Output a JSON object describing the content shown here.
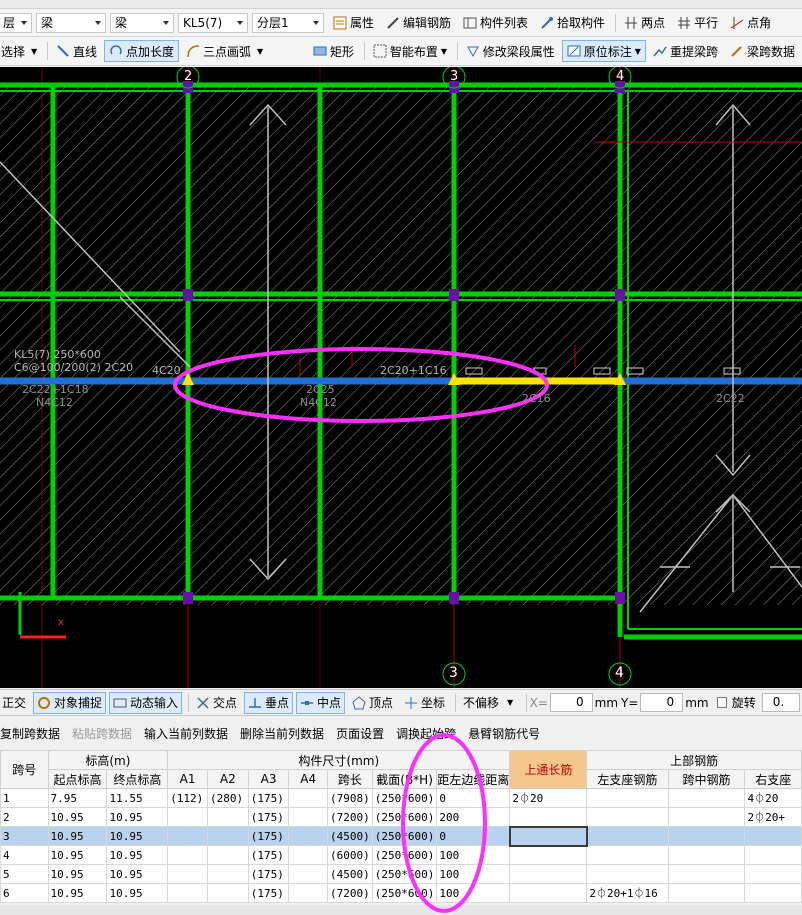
{
  "toolbar1": {
    "floor_value": "层",
    "category_value": "梁",
    "type_value": "梁",
    "component_value": "KL5(7)",
    "layer_value": "分层1",
    "properties_label": "属性",
    "edit_rebar_label": "编辑钢筋",
    "component_list_label": "构件列表",
    "pick_component_label": "拾取构件",
    "two_points_label": "两点",
    "parallel_label": "平行",
    "point_angle_label": "点角"
  },
  "toolbar2": {
    "select_label": "选择",
    "line_label": "直线",
    "point_length_label": "点加长度",
    "three_point_arc_label": "三点画弧",
    "rectangle_label": "矩形",
    "smart_layout_label": "智能布置",
    "modify_segment_label": "修改梁段属性",
    "in_place_label": "原位标注",
    "re_extract_span_label": "重提梁跨",
    "span_data_label": "梁跨数据"
  },
  "canvas": {
    "axis_labels": [
      "2",
      "3",
      "4"
    ],
    "bottom_axis_labels": [
      "3",
      "4"
    ],
    "beam_label_1": "KL5(7) 250*600",
    "beam_label_2": "C6@100/200(2) 2C20",
    "beam_label_3": "2C22+1C18",
    "beam_label_4": "N4C12",
    "beam_label_5": "4C20",
    "beam_label_6": "2C25",
    "beam_label_7": "N4C12",
    "beam_label_8": "2C20+1C16",
    "beam_label_9": "2C16",
    "beam_label_10": "2C22",
    "colors": {
      "grid": "#00d000",
      "beam": "#1f6fd6",
      "selected": "#ffe400",
      "highlight": "#ff30ff",
      "column": "#6a0dad"
    }
  },
  "statusbar": {
    "orthogonal_label": "正交",
    "snap_label": "对象捕捉",
    "dynamic_input_label": "动态输入",
    "intersection_label": "交点",
    "perpendicular_label": "垂点",
    "midpoint_label": "中点",
    "vertex_label": "顶点",
    "coordinate_label": "坐标",
    "offset_value": "不偏移",
    "x_label": "X=",
    "x_value": "0",
    "unit_1": "mm",
    "y_label": "Y=",
    "y_value": "0",
    "unit_2": "mm",
    "rotate_label": "旋转",
    "rotate_value": "0."
  },
  "grid_toolbar": {
    "copy_span_label": "复制跨数据",
    "paste_span_label": "粘贴跨数据",
    "input_column_label": "输入当前列数据",
    "delete_column_label": "删除当前列数据",
    "page_setup_label": "页面设置",
    "adjust_start_label": "调换起始跨",
    "cantilever_label": "悬臂钢筋代号"
  },
  "table": {
    "group_headers": {
      "span": "跨号",
      "elevation": "标高(m)",
      "dimension": "构件尺寸(mm)",
      "top_through": "上通长筋",
      "top_rebar": "上部钢筋"
    },
    "columns": [
      "起点标高",
      "终点标高",
      "A1",
      "A2",
      "A3",
      "A4",
      "跨长",
      "截面(B*H)",
      "距左边线距离",
      "左支座钢筋",
      "跨中钢筋",
      "右支座"
    ],
    "rows": [
      {
        "no": "1",
        "start": "7.95",
        "end": "11.55",
        "a1": "(112)",
        "a2": "(280)",
        "a3": "(175)",
        "a4": "",
        "len": "(7908)",
        "sec": "(250*600)",
        "dist": "0",
        "top": "2⏀20",
        "left": "",
        "mid": "",
        "right": "4⏀20"
      },
      {
        "no": "2",
        "start": "10.95",
        "end": "10.95",
        "a1": "",
        "a2": "",
        "a3": "(175)",
        "a4": "",
        "len": "(7200)",
        "sec": "(250*600)",
        "dist": "200",
        "top": "",
        "left": "",
        "mid": "",
        "right": "2⏀20+"
      },
      {
        "no": "3",
        "start": "10.95",
        "end": "10.95",
        "a1": "",
        "a2": "",
        "a3": "(175)",
        "a4": "",
        "len": "(4500)",
        "sec": "(250*600)",
        "dist": "0",
        "top": "",
        "left": "",
        "mid": "",
        "right": ""
      },
      {
        "no": "4",
        "start": "10.95",
        "end": "10.95",
        "a1": "",
        "a2": "",
        "a3": "(175)",
        "a4": "",
        "len": "(6000)",
        "sec": "(250*600)",
        "dist": "100",
        "top": "",
        "left": "",
        "mid": "",
        "right": ""
      },
      {
        "no": "5",
        "start": "10.95",
        "end": "10.95",
        "a1": "",
        "a2": "",
        "a3": "(175)",
        "a4": "",
        "len": "(4500)",
        "sec": "(250*600)",
        "dist": "100",
        "top": "",
        "left": "",
        "mid": "",
        "right": ""
      },
      {
        "no": "6",
        "start": "10.95",
        "end": "10.95",
        "a1": "",
        "a2": "",
        "a3": "(175)",
        "a4": "",
        "len": "(7200)",
        "sec": "(250*600)",
        "dist": "100",
        "top": "",
        "left": "2⏀20+1⏀16",
        "mid": "",
        "right": ""
      }
    ]
  }
}
